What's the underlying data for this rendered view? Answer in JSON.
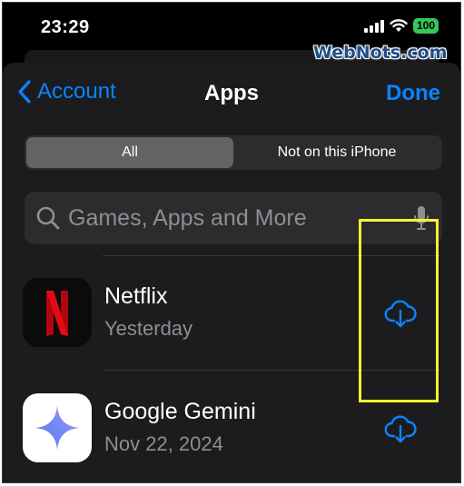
{
  "status": {
    "time": "23:29",
    "battery": "100"
  },
  "watermark": "WebNots.com",
  "nav": {
    "back_label": "Account",
    "title": "Apps",
    "done_label": "Done"
  },
  "segments": {
    "all": "All",
    "not_on_device": "Not on this iPhone",
    "selected": "All"
  },
  "search": {
    "placeholder": "Games, Apps and More"
  },
  "apps": [
    {
      "name": "Netflix",
      "date": "Yesterday",
      "icon": "netflix-logo-icon"
    },
    {
      "name": "Google Gemini",
      "date": "Nov 22, 2024",
      "icon": "gemini-star-icon"
    }
  ],
  "colors": {
    "accent": "#0a84ff",
    "highlight": "#f5f52a",
    "netflix_red": "#e50914",
    "battery": "#34c759"
  }
}
